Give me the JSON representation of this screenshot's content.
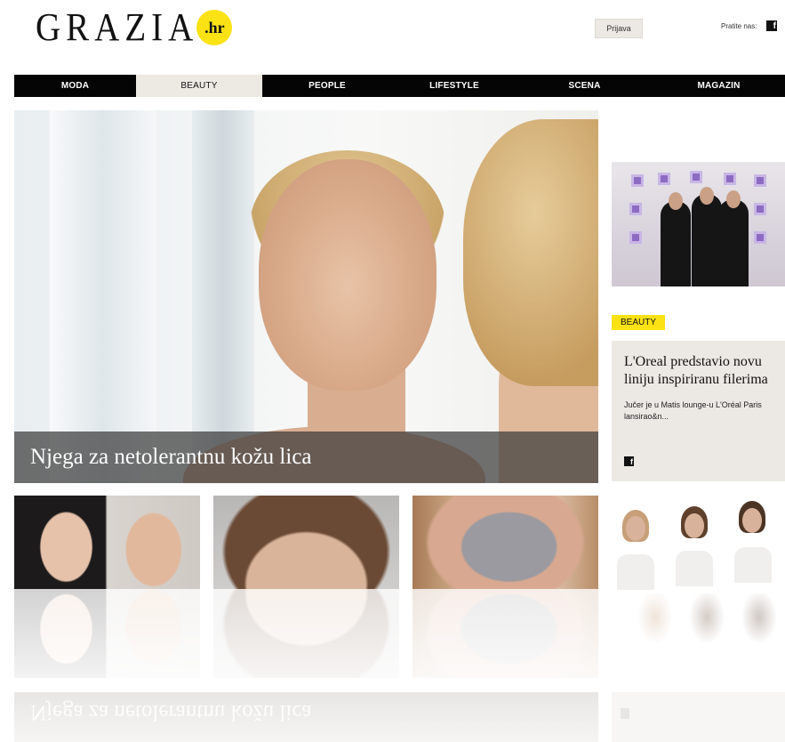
{
  "header": {
    "logo_text": "GRAZIA",
    "logo_badge": ".hr",
    "login_label": "Prijava",
    "follow_label": "Pratite nas:",
    "facebook_icon": "f"
  },
  "nav": {
    "items": [
      {
        "label": "MODA",
        "active": false
      },
      {
        "label": "BEAUTY",
        "active": true
      },
      {
        "label": "PEOPLE",
        "active": false
      },
      {
        "label": "LIFESTYLE",
        "active": false
      },
      {
        "label": "SCENA",
        "active": false
      },
      {
        "label": "MAGAZIN",
        "active": false
      }
    ]
  },
  "hero": {
    "title": "Njega za netolerantnu kožu lica"
  },
  "sidebar": {
    "tag": "BEAUTY",
    "card_title": "L'Oreal predstavio novu liniju inspiriranu filerima",
    "card_excerpt": "Jučer je u Matis lounge-u L'Oréal Paris lansirao&n...",
    "card_facebook_icon": "f"
  },
  "colors": {
    "accent_yellow": "#fbe214",
    "nav_bg": "#050505",
    "nav_active_bg": "#ede9e3",
    "card_bg": "#ece9e4"
  }
}
